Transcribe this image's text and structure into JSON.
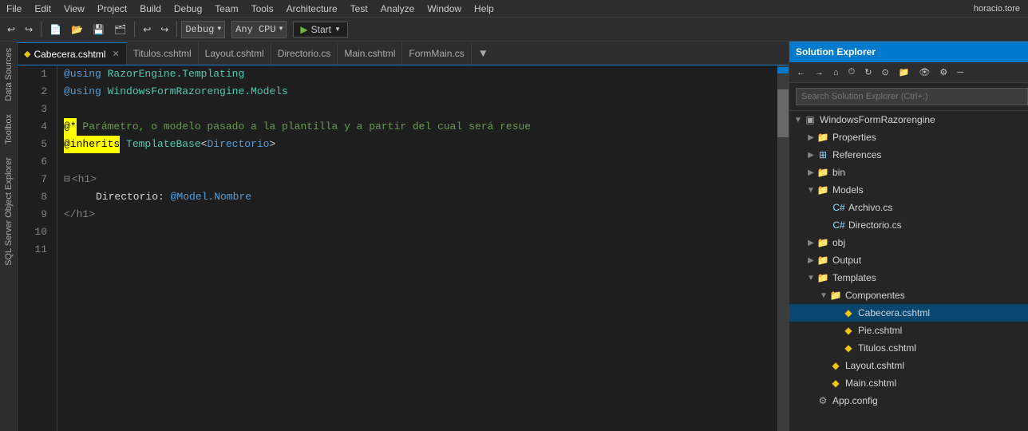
{
  "menu": {
    "items": [
      "File",
      "Edit",
      "View",
      "Project",
      "Build",
      "Debug",
      "Team",
      "Tools",
      "Architecture",
      "Test",
      "Analyze",
      "Window",
      "Help"
    ]
  },
  "toolbar": {
    "debug_config": "Debug",
    "platform": "Any CPU",
    "run_label": "▶ Start",
    "user": "horacio.tore"
  },
  "tabs": [
    {
      "label": "Cabecera.cshtml",
      "active": true,
      "closeable": true
    },
    {
      "label": "Titulos.cshtml",
      "active": false,
      "closeable": false
    },
    {
      "label": "Layout.cshtml",
      "active": false,
      "closeable": false
    },
    {
      "label": "Directorio.cs",
      "active": false,
      "closeable": false
    },
    {
      "label": "Main.cshtml",
      "active": false,
      "closeable": false
    },
    {
      "label": "FormMain.cs",
      "active": false,
      "closeable": false
    }
  ],
  "left_panels": [
    "Data Sources",
    "Toolbox",
    "SQL Server Object Explorer"
  ],
  "code_lines": [
    {
      "num": 1,
      "content": "@using RazorEngine.Templating"
    },
    {
      "num": 2,
      "content": "@using WindowsFormRazorengine.Models"
    },
    {
      "num": 3,
      "content": ""
    },
    {
      "num": 4,
      "content": "@* Parámetro, o modelo pasado a la plantilla y a partir del cual será resue"
    },
    {
      "num": 5,
      "content": "@inherits TemplateBase<Directorio>"
    },
    {
      "num": 6,
      "content": ""
    },
    {
      "num": 7,
      "content": "<h1>"
    },
    {
      "num": 8,
      "content": "    Directorio: @Model.Nombre"
    },
    {
      "num": 9,
      "content": "</h1>"
    },
    {
      "num": 10,
      "content": ""
    },
    {
      "num": 11,
      "content": ""
    }
  ],
  "solution_explorer": {
    "title": "Solution Explorer",
    "search_placeholder": "Search Solution Explorer (Ctrl+;)",
    "toolbar_icons": [
      "back",
      "forward",
      "home",
      "history",
      "refresh",
      "track",
      "new-folder",
      "show-all",
      "properties",
      "minus",
      "gear"
    ],
    "tree": [
      {
        "id": "root",
        "label": "WindowsFormRazorengine",
        "level": 0,
        "expanded": true,
        "type": "solution"
      },
      {
        "id": "properties",
        "label": "Properties",
        "level": 1,
        "expanded": false,
        "type": "folder"
      },
      {
        "id": "references",
        "label": "References",
        "level": 1,
        "expanded": false,
        "type": "references"
      },
      {
        "id": "bin",
        "label": "bin",
        "level": 1,
        "expanded": false,
        "type": "folder"
      },
      {
        "id": "models",
        "label": "Models",
        "level": 1,
        "expanded": true,
        "type": "folder"
      },
      {
        "id": "archivo",
        "label": "Archivo.cs",
        "level": 2,
        "expanded": false,
        "type": "cs"
      },
      {
        "id": "directoriocs",
        "label": "Directorio.cs",
        "level": 2,
        "expanded": false,
        "type": "cs"
      },
      {
        "id": "obj",
        "label": "obj",
        "level": 1,
        "expanded": false,
        "type": "folder"
      },
      {
        "id": "output",
        "label": "Output",
        "level": 1,
        "expanded": false,
        "type": "folder"
      },
      {
        "id": "templates",
        "label": "Templates",
        "level": 1,
        "expanded": true,
        "type": "folder"
      },
      {
        "id": "componentes",
        "label": "Componentes",
        "level": 2,
        "expanded": true,
        "type": "folder"
      },
      {
        "id": "cabecera",
        "label": "Cabecera.cshtml",
        "level": 3,
        "expanded": false,
        "type": "cshtml",
        "selected": true
      },
      {
        "id": "pie",
        "label": "Pie.cshtml",
        "level": 3,
        "expanded": false,
        "type": "cshtml"
      },
      {
        "id": "titulos",
        "label": "Titulos.cshtml",
        "level": 3,
        "expanded": false,
        "type": "cshtml"
      },
      {
        "id": "layout",
        "label": "Layout.cshtml",
        "level": 2,
        "expanded": false,
        "type": "cshtml"
      },
      {
        "id": "main",
        "label": "Main.cshtml",
        "level": 2,
        "expanded": false,
        "type": "cshtml"
      },
      {
        "id": "appconfig",
        "label": "App.config",
        "level": 1,
        "expanded": false,
        "type": "config"
      }
    ]
  }
}
